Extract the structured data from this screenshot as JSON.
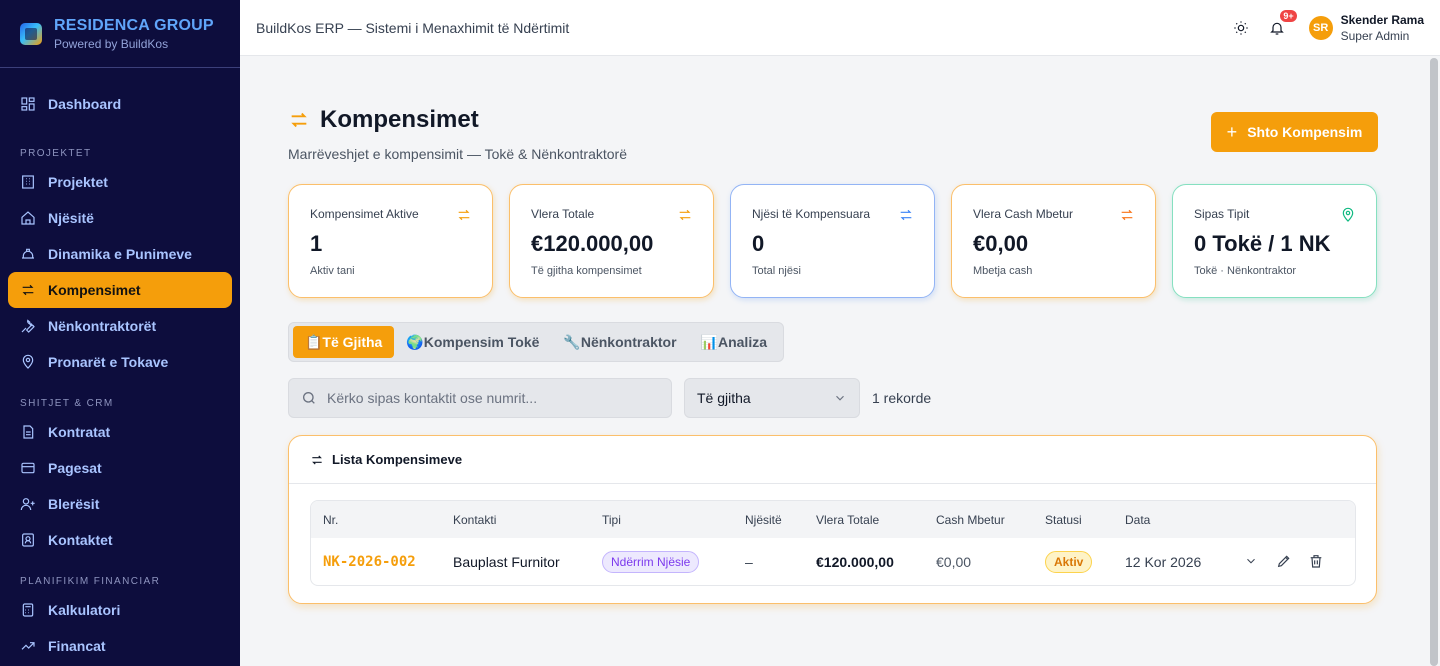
{
  "brand": {
    "title": "RESIDENCA GROUP",
    "subtitle": "Powered by BuildKos"
  },
  "sidebar": {
    "top_item": {
      "label": "Dashboard",
      "icon": "dashboard-icon"
    },
    "sections": [
      {
        "title": "PROJEKTET",
        "items": [
          {
            "label": "Projektet",
            "icon": "building-icon"
          },
          {
            "label": "Njësitë",
            "icon": "home-icon"
          },
          {
            "label": "Dinamika e Punimeve",
            "icon": "hardhat-icon"
          },
          {
            "label": "Kompensimet",
            "icon": "swap-icon",
            "active": true
          },
          {
            "label": "Nënkontraktorët",
            "icon": "wrench-icon"
          },
          {
            "label": "Pronarët e Tokave",
            "icon": "map-pin-icon"
          }
        ]
      },
      {
        "title": "SHITJET & CRM",
        "items": [
          {
            "label": "Kontratat",
            "icon": "document-icon"
          },
          {
            "label": "Pagesat",
            "icon": "card-icon"
          },
          {
            "label": "Blerësit",
            "icon": "user-plus-icon"
          },
          {
            "label": "Kontaktet",
            "icon": "contact-icon"
          }
        ]
      },
      {
        "title": "PLANIFIKIM FINANCIAR",
        "items": [
          {
            "label": "Kalkulatori",
            "icon": "calculator-icon"
          },
          {
            "label": "Financat",
            "icon": "trending-icon"
          }
        ]
      }
    ]
  },
  "topbar": {
    "title": "BuildKos ERP — Sistemi i Menaxhimit të Ndërtimit",
    "notif_count": "9+",
    "avatar_initials": "SR",
    "user_name": "Skender Rama",
    "user_role": "Super Admin"
  },
  "page": {
    "title": "Kompensimet",
    "subtitle": "Marrëveshjet e kompensimit — Tokë & Nënkontraktorë",
    "add_button": "Shto Kompensim",
    "add_plus": "+"
  },
  "stats": [
    {
      "label": "Kompensimet Aktive",
      "value": "1",
      "note": "Aktiv tani",
      "icon": "swap-icon",
      "accent": "#f59e0b"
    },
    {
      "label": "Vlera Totale",
      "value": "€120.000,00",
      "note": "Të gjitha kompensimet",
      "icon": "swap-icon",
      "accent": "#f59e0b"
    },
    {
      "label": "Njësi të Kompensuara",
      "value": "0",
      "note": "Total njësi",
      "icon": "swap-icon",
      "accent": "#3b82f6"
    },
    {
      "label": "Vlera Cash Mbetur",
      "value": "€0,00",
      "note": "Mbetja cash",
      "icon": "swap-icon",
      "accent": "#f97316"
    },
    {
      "label": "Sipas Tipit",
      "value": "0 Tokë / 1 NK",
      "note": "Tokë · Nënkontraktor",
      "icon": "map-pin-icon",
      "accent": "#10b981"
    }
  ],
  "tabs": [
    "📋Të Gjitha",
    "🌍Kompensim Tokë",
    "🔧Nënkontraktor",
    "📊Analiza"
  ],
  "filters": {
    "search_placeholder": "Kërko sipas kontaktit ose numrit...",
    "select_value": "Të gjitha",
    "count": "1 rekorde"
  },
  "list": {
    "title": "Lista Kompensimeve",
    "columns": [
      "Nr.",
      "Kontakti",
      "Tipi",
      "Njësitë",
      "Vlera Totale",
      "Cash Mbetur",
      "Statusi",
      "Data"
    ],
    "rows": [
      {
        "nr": "NK-2026-002",
        "kontakti": "Bauplast Furnitor",
        "tipi": "Ndërrim Njësie",
        "njesite": "–",
        "vlera": "€120.000,00",
        "cash": "€0,00",
        "statusi": "Aktiv",
        "data": "12 Kor 2026"
      }
    ]
  },
  "colors": {
    "sidebar_bg": "#0d0d3d",
    "accent": "#f59e0b",
    "brand": "#60a5fa"
  }
}
